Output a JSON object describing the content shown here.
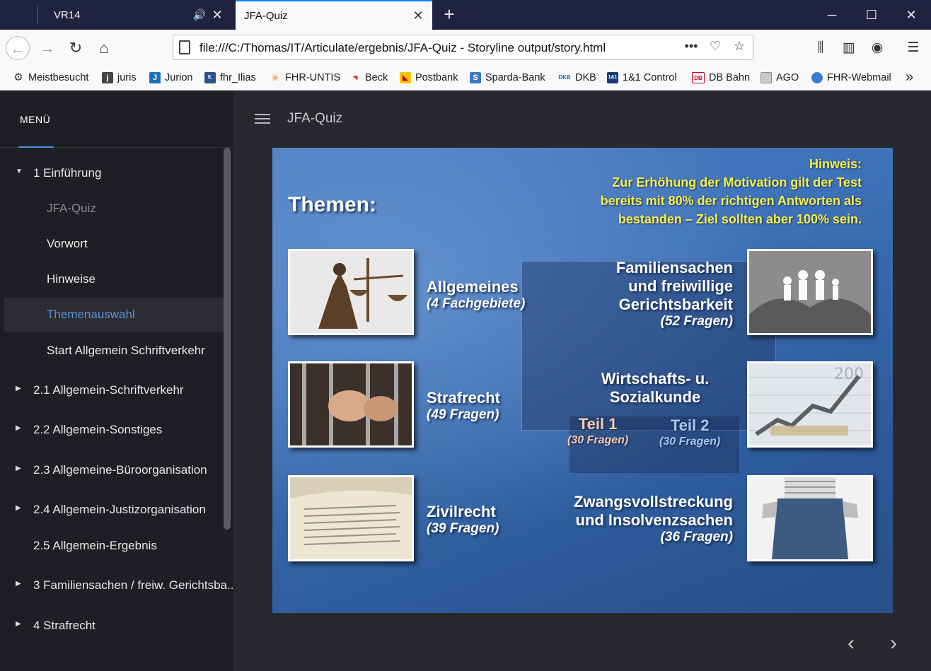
{
  "browser": {
    "tabs": [
      {
        "title": "VR14",
        "active": false
      },
      {
        "title": "JFA-Quiz",
        "active": true
      }
    ],
    "url": "file:///C:/Thomas/IT/Articulate/ergebnis/JFA-Quiz - Storyline output/story.html",
    "bookmarks": [
      "Meistbesucht",
      "juris",
      "Jurion",
      "fhr_Ilias",
      "FHR-UNTIS",
      "Beck",
      "Postbank",
      "Sparda-Bank",
      "DKB",
      "1&1 Control",
      "DB Bahn",
      "AGO",
      "FHR-Webmail"
    ],
    "icons": {
      "new_tab": "+",
      "more": "»"
    }
  },
  "player": {
    "menu_label": "MENÜ",
    "title": "JFA-Quiz",
    "menu": [
      {
        "label": "1 Einführung",
        "level": "top",
        "expanded": true
      },
      {
        "label": "JFA-Quiz",
        "level": "sub",
        "state": "visited"
      },
      {
        "label": "Vorwort",
        "level": "sub"
      },
      {
        "label": "Hinweise",
        "level": "sub"
      },
      {
        "label": "Themenauswahl",
        "level": "sub",
        "state": "selected"
      },
      {
        "label": "Start Allgemein Schriftverkehr",
        "level": "sub"
      },
      {
        "label": "2.1 Allgemein-Schriftverkehr",
        "level": "top",
        "expanded": false
      },
      {
        "label": "2.2 Allgemein-Sonstiges",
        "level": "top",
        "expanded": false
      },
      {
        "label": "2.3 Allgemeine-Büroorganisation",
        "level": "top",
        "expanded": false
      },
      {
        "label": "2.4 Allgemein-Justizorganisation",
        "level": "top",
        "expanded": false
      },
      {
        "label": "2.5 Allgemein-Ergebnis",
        "level": "top"
      },
      {
        "label": "3 Familiensachen / freiw. Gerichtsba...",
        "level": "top",
        "expanded": false
      },
      {
        "label": "4 Strafrecht",
        "level": "top",
        "expanded": false
      }
    ]
  },
  "slide": {
    "hinweis": [
      "Hinweis:",
      "Zur Erhöhung der Motivation gilt der Test",
      "bereits mit 80% der richtigen Antworten als",
      "bestanden – Ziel sollten aber 100% sein."
    ],
    "heading": "Themen:",
    "topics": {
      "allgemeines": {
        "title": "Allgemeines",
        "count": "(4 Fachgebiete)"
      },
      "strafrecht": {
        "title": "Strafrecht",
        "count": "(49 Fragen)"
      },
      "zivilrecht": {
        "title": "Zivilrecht",
        "count": "(39 Fragen)"
      },
      "familie": {
        "title1": "Familiensachen",
        "title2": "und freiwillige",
        "title3": "Gerichtsbarkeit",
        "count": "(52 Fragen)"
      },
      "wirtschaft": {
        "title1": "Wirtschafts- u.",
        "title2": "Sozialkunde",
        "teil1": "Teil 1",
        "teil1_count": "(30 Fragen)",
        "teil2": "Teil 2",
        "teil2_count": "(30 Fragen)"
      },
      "zwang": {
        "title1": "Zwangsvollstreckung",
        "title2": "und Insolvenzsachen",
        "count": "(36 Fragen)"
      }
    },
    "colors": {
      "hinweis": "#f5f04a",
      "teil1": "#f6c9b0",
      "teil2": "#a9c6ee"
    }
  }
}
